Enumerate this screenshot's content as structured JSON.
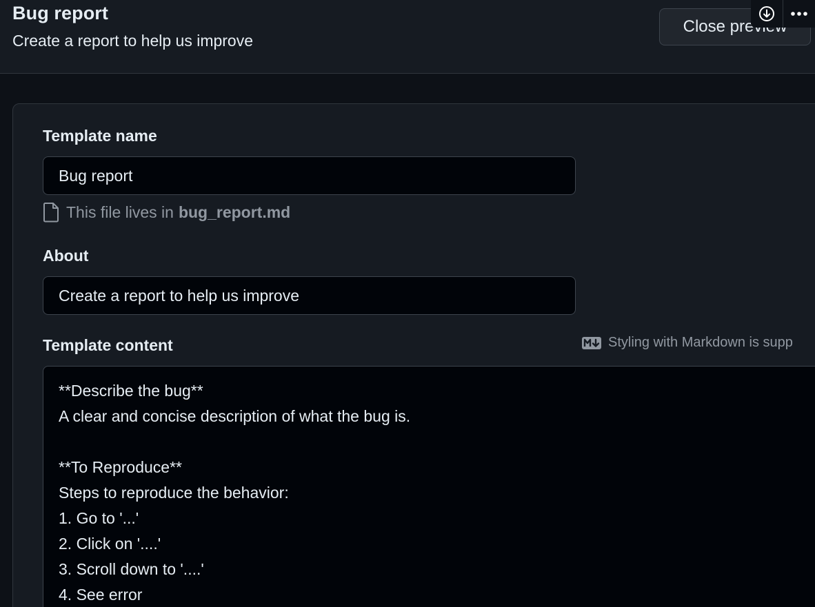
{
  "header": {
    "title": "Bug report",
    "subtitle": "Create a report to help us improve",
    "close_preview_label": "Close preview",
    "tools": [
      "download-icon",
      "more-icon"
    ]
  },
  "form": {
    "template_name_label": "Template name",
    "template_name_value": "Bug report",
    "file_note_prefix": "This file lives in",
    "file_note_filename": "bug_report.md",
    "about_label": "About",
    "about_value": "Create a report to help us improve",
    "template_content_label": "Template content",
    "markdown_hint": "Styling with Markdown is supp",
    "template_content_lines": [
      "**Describe the bug**",
      "A clear and concise description of what the bug is.",
      "",
      "**To Reproduce**",
      "Steps to reproduce the behavior:",
      "1. Go to '...'",
      "2. Click on '....'",
      "3. Scroll down to '....'",
      "4. See error"
    ]
  },
  "colors": {
    "background": "#0d1117",
    "header_background": "#161b22",
    "input_background": "#010409",
    "border": "#30363d",
    "text": "#e6edf3",
    "muted_text": "#9198a1"
  }
}
